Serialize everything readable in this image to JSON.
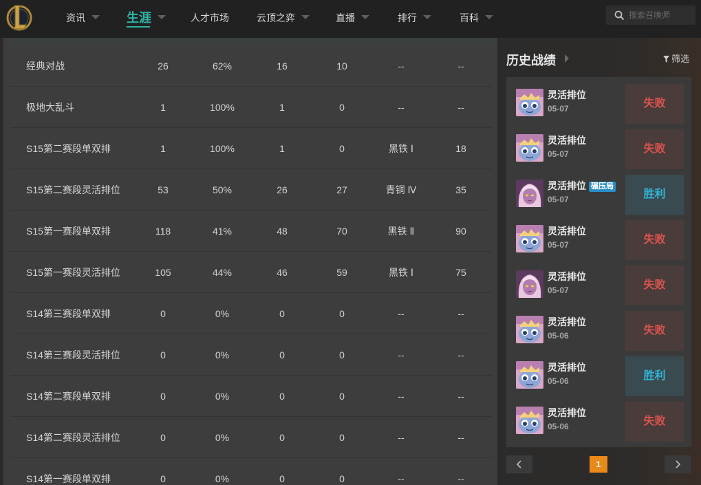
{
  "nav": {
    "items": [
      {
        "label": "资讯",
        "caret": true
      },
      {
        "label": "生涯",
        "caret": true,
        "active": true
      },
      {
        "label": "人才市场",
        "caret": false
      },
      {
        "label": "云顶之弈",
        "caret": true
      },
      {
        "label": "直播",
        "caret": true
      },
      {
        "label": "排行",
        "caret": true
      },
      {
        "label": "百科",
        "caret": true
      }
    ],
    "search_placeholder": "搜索召唤师"
  },
  "stats_table": {
    "rows": [
      {
        "mode": "经典对战",
        "games": "26",
        "winrate": "62%",
        "wins": "16",
        "losses": "10",
        "tier": "--",
        "points": "--"
      },
      {
        "mode": "极地大乱斗",
        "games": "1",
        "winrate": "100%",
        "wins": "1",
        "losses": "0",
        "tier": "--",
        "points": "--"
      },
      {
        "mode": "S15第二赛段单双排",
        "games": "1",
        "winrate": "100%",
        "wins": "1",
        "losses": "0",
        "tier": "黑铁 Ⅰ",
        "points": "18"
      },
      {
        "mode": "S15第二赛段灵活排位",
        "games": "53",
        "winrate": "50%",
        "wins": "26",
        "losses": "27",
        "tier": "青铜 Ⅳ",
        "points": "35"
      },
      {
        "mode": "S15第一赛段单双排",
        "games": "118",
        "winrate": "41%",
        "wins": "48",
        "losses": "70",
        "tier": "黑铁 Ⅱ",
        "points": "90"
      },
      {
        "mode": "S15第一赛段灵活排位",
        "games": "105",
        "winrate": "44%",
        "wins": "46",
        "losses": "59",
        "tier": "黑铁 Ⅰ",
        "points": "75"
      },
      {
        "mode": "S14第三赛段单双排",
        "games": "0",
        "winrate": "0%",
        "wins": "0",
        "losses": "0",
        "tier": "--",
        "points": "--"
      },
      {
        "mode": "S14第三赛段灵活排位",
        "games": "0",
        "winrate": "0%",
        "wins": "0",
        "losses": "0",
        "tier": "--",
        "points": "--"
      },
      {
        "mode": "S14第二赛段单双排",
        "games": "0",
        "winrate": "0%",
        "wins": "0",
        "losses": "0",
        "tier": "--",
        "points": "--"
      },
      {
        "mode": "S14第二赛段灵活排位",
        "games": "0",
        "winrate": "0%",
        "wins": "0",
        "losses": "0",
        "tier": "--",
        "points": "--"
      },
      {
        "mode": "S14第一赛段单双排",
        "games": "0",
        "winrate": "0%",
        "wins": "0",
        "losses": "0",
        "tier": "--",
        "points": "--"
      }
    ]
  },
  "history": {
    "title": "历史战绩",
    "filter_label": "筛选",
    "matches": [
      {
        "mode": "灵活排位",
        "date": "05-07",
        "badge": "",
        "result": "失败",
        "win": false,
        "champion": "yordle"
      },
      {
        "mode": "灵活排位",
        "date": "05-07",
        "badge": "",
        "result": "失败",
        "win": false,
        "champion": "yordle"
      },
      {
        "mode": "灵活排位",
        "date": "05-07",
        "badge": "碾压局",
        "result": "胜利",
        "win": true,
        "champion": "sorceress"
      },
      {
        "mode": "灵活排位",
        "date": "05-07",
        "badge": "",
        "result": "失败",
        "win": false,
        "champion": "yordle"
      },
      {
        "mode": "灵活排位",
        "date": "05-07",
        "badge": "",
        "result": "失败",
        "win": false,
        "champion": "sorceress"
      },
      {
        "mode": "灵活排位",
        "date": "05-06",
        "badge": "",
        "result": "失败",
        "win": false,
        "champion": "yordle"
      },
      {
        "mode": "灵活排位",
        "date": "05-06",
        "badge": "",
        "result": "胜利",
        "win": true,
        "champion": "yordle"
      },
      {
        "mode": "灵活排位",
        "date": "05-06",
        "badge": "",
        "result": "失败",
        "win": false,
        "champion": "yordle"
      }
    ],
    "current_page": "1"
  },
  "colors": {
    "accent": "#2fb3a6",
    "win": "#33b5d6",
    "lose": "#d9534f",
    "page_active": "#e8891a"
  }
}
